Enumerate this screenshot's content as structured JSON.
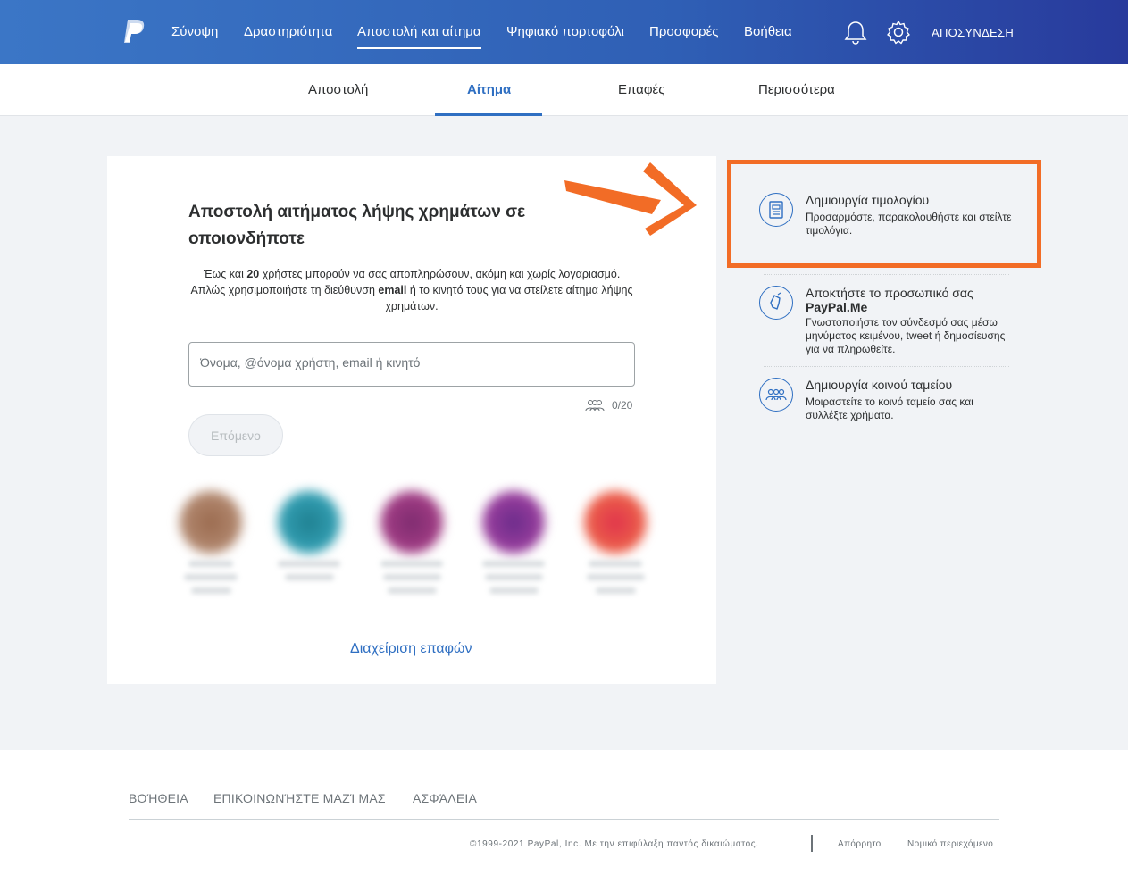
{
  "header": {
    "nav": [
      "Σύνοψη",
      "Δραστηριότητα",
      "Αποστολή και αίτημα",
      "Ψηφιακό πορτοφόλι",
      "Προσφορές",
      "Βοήθεια"
    ],
    "active_nav": "Αποστολή και αίτημα",
    "logout": "ΑΠΟΣΥΝΔΕΣΗ",
    "icons": [
      "paypal-logo",
      "bell-icon",
      "gear-icon"
    ]
  },
  "subnav": {
    "tabs": [
      "Αποστολή",
      "Αίτημα",
      "Επαφές",
      "Περισσότερα"
    ],
    "active": "Αίτημα"
  },
  "request_card": {
    "title": "Αποστολή αιτήματος λήψης χρημάτων σε οποιονδήποτε",
    "desc_1": "Έως και ",
    "desc_count": "20",
    "desc_2": " χρήστες μπορούν να σας αποπληρώσουν, ακόμη και χωρίς λογαριασμό. Απλώς χρησιμοποιήστε τη διεύθυνση ",
    "desc_email": "email",
    "desc_3": " ή το κινητό τους για να στείλετε αίτημα λήψης χρημάτων.",
    "input_placeholder": "Όνομα, @όνομα χρήστη, email ή κινητό",
    "counter": "0/20",
    "next_button": "Επόμενο",
    "manage_contacts": "Διαχείριση επαφών"
  },
  "sidebar": {
    "items": [
      {
        "title": "Δημιουργία τιμολογίου",
        "desc": "Προσαρμόστε, παρακολουθήστε και στείλτε τιμολόγια.",
        "icon": "invoice-icon"
      },
      {
        "title": "Αποκτήστε το προσωπικό σας",
        "title_bold": "PayPal.Me",
        "desc": "Γνωστοποιήστε τον σύνδεσμό σας μέσω μηνύματος κειμένου, tweet ή δημοσίευσης για να πληρωθείτε.",
        "icon": "paypalme-icon"
      },
      {
        "title": "Δημιουργία κοινού ταμείου",
        "desc": "Μοιραστείτε το κοινό ταμείο σας και συλλέξτε χρήματα.",
        "icon": "group-icon"
      }
    ]
  },
  "footer": {
    "links": [
      "ΒΟΉΘΕΙΑ",
      "ΕΠΙΚΟΙΝΩΝΉΣΤΕ ΜΑΖΊ ΜΑΣ",
      "ΑΣΦΆΛΕΙΑ"
    ],
    "copyright": "©1999-2021 PayPal, Inc. Με την επιφύλαξη παντός δικαιώματος.",
    "privacy": "Απόρρητο",
    "legal": "Νομικό περιεχόμενο"
  },
  "colors": {
    "header_start": "#3b76c6",
    "header_end": "#283a9c",
    "accent": "#2f6fc2",
    "highlight": "#f26c26"
  }
}
